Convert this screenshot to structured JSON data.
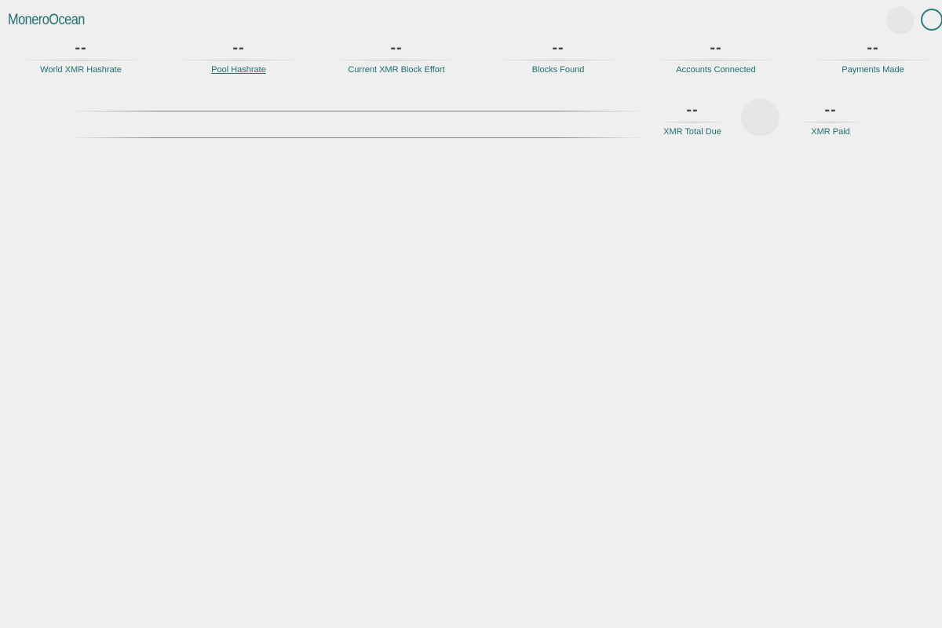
{
  "header": {
    "logo": "MoneroOcean"
  },
  "top_stats": [
    {
      "value": "--",
      "label": "World XMR Hashrate"
    },
    {
      "value": "--",
      "label": "Pool Hashrate"
    },
    {
      "value": "--",
      "label": "Current XMR Block Effort"
    },
    {
      "value": "--",
      "label": "Blocks Found"
    },
    {
      "value": "--",
      "label": "Accounts Connected"
    },
    {
      "value": "--",
      "label": "Payments Made"
    }
  ],
  "account": {
    "address_value": "",
    "total_due": {
      "value": "--",
      "label": "XMR Total Due"
    },
    "paid": {
      "value": "--",
      "label": "XMR Paid"
    }
  },
  "colors": {
    "background": "#efefef",
    "accent": "#1f6f6c",
    "value_text": "#4c4c4c"
  }
}
